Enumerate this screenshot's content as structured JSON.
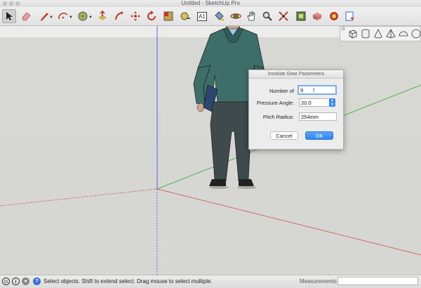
{
  "window": {
    "title": "Untitled - SketchUp Pro"
  },
  "toolbar": {
    "tools": [
      {
        "name": "select-tool",
        "icon": "arrow-cursor-icon"
      },
      {
        "name": "eraser-tool",
        "icon": "eraser-icon"
      },
      {
        "name": "line-tool",
        "icon": "pencil-icon"
      },
      {
        "name": "arc-tool",
        "icon": "arc-icon"
      },
      {
        "name": "push-pull-tool",
        "icon": "push-pull-icon"
      },
      {
        "name": "move-tool",
        "icon": "move-arrows-icon"
      },
      {
        "name": "follow-me-tool",
        "icon": "follow-me-icon"
      },
      {
        "name": "rotate-tool",
        "icon": "rotate-icon"
      },
      {
        "name": "offset-tool",
        "icon": "offset-icon"
      },
      {
        "name": "scale-tool",
        "icon": "scale-icon"
      },
      {
        "name": "tape-measure-tool",
        "icon": "tape-measure-icon"
      },
      {
        "name": "text-tool",
        "icon": "text-icon"
      },
      {
        "name": "paint-bucket-tool",
        "icon": "paint-bucket-icon"
      },
      {
        "name": "orbit-tool",
        "icon": "orbit-icon"
      },
      {
        "name": "pan-tool",
        "icon": "hand-icon"
      },
      {
        "name": "zoom-tool",
        "icon": "magnifier-icon"
      },
      {
        "name": "zoom-extents-tool",
        "icon": "zoom-extents-icon"
      },
      {
        "name": "warehouse-button",
        "icon": "warehouse-icon"
      },
      {
        "name": "components-button",
        "icon": "components-icon"
      },
      {
        "name": "extension-warehouse-button",
        "icon": "extension-icon"
      },
      {
        "name": "send-to-layout-button",
        "icon": "layout-icon"
      }
    ],
    "text_tool_glyph": "A1"
  },
  "shapes_toolbar": {
    "icons": [
      "box-icon",
      "cylinder-icon",
      "cone-icon",
      "pyramid-icon",
      "dome-icon",
      "sphere-icon"
    ]
  },
  "dialog": {
    "title": "Involute Gear Parameters",
    "fields": [
      {
        "label": "Number of",
        "value": "9"
      },
      {
        "label": "Pressure Angle:",
        "value": "20.0"
      },
      {
        "label": "Pitch Radius:",
        "value": "254mm"
      }
    ],
    "cancel_label": "Cancel",
    "ok_label": "OK"
  },
  "statusbar": {
    "message": "Select objects. Shift to extend select. Drag mouse to select multiple.",
    "measurements_label": "Measurements",
    "measurements_value": ""
  },
  "colors": {
    "accent": "#3b8cf0",
    "red_axis": "#c44",
    "green_axis": "#3a3",
    "blue_axis": "#44c",
    "jacket": "#3e6e6a",
    "trousers": "#3f4a4c"
  }
}
